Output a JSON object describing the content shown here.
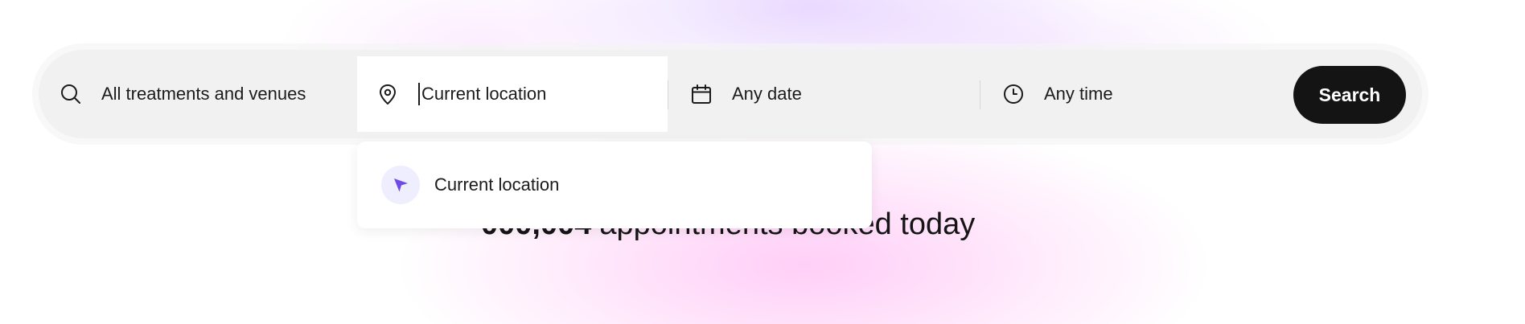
{
  "search": {
    "treatments_label": "All treatments and venues",
    "location_value": "Current location",
    "date_label": "Any date",
    "time_label": "Any time",
    "button_label": "Search"
  },
  "location_dropdown": {
    "items": [
      {
        "label": "Current location",
        "icon": "navigation-arrow-icon"
      }
    ]
  },
  "headline": {
    "count": "000,004",
    "text": "appointments booked today"
  },
  "colors": {
    "accent": "#6f4ce8",
    "accent_bg": "#efeefe",
    "button_bg": "#141414",
    "bar_bg": "#f1f1f1"
  }
}
